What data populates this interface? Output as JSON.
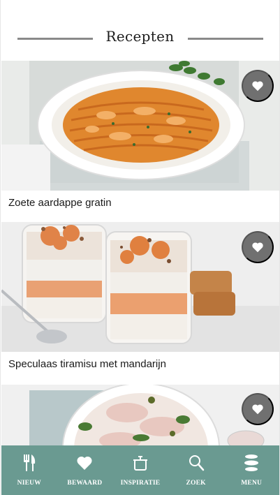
{
  "section": {
    "title": "Recepten"
  },
  "recipes": [
    {
      "title": "Zoete aardappe gratin",
      "favorite_icon": "heart-icon"
    },
    {
      "title": "Speculaas tiramisu met mandarijn",
      "favorite_icon": "heart-icon"
    },
    {
      "title": "",
      "favorite_icon": "heart-icon"
    }
  ],
  "nav": {
    "items": [
      {
        "label": "NIEUW",
        "icon": "fork-knife-icon"
      },
      {
        "label": "BEWAARD",
        "icon": "heart-icon"
      },
      {
        "label": "INSPIRATIE",
        "icon": "pot-icon"
      },
      {
        "label": "ZOEK",
        "icon": "search-icon"
      },
      {
        "label": "MENU",
        "icon": "menu-icon"
      }
    ]
  },
  "colors": {
    "nav_background": "#6a9a91",
    "favorite_button": "#707070",
    "rule": "#8a8a8a"
  }
}
